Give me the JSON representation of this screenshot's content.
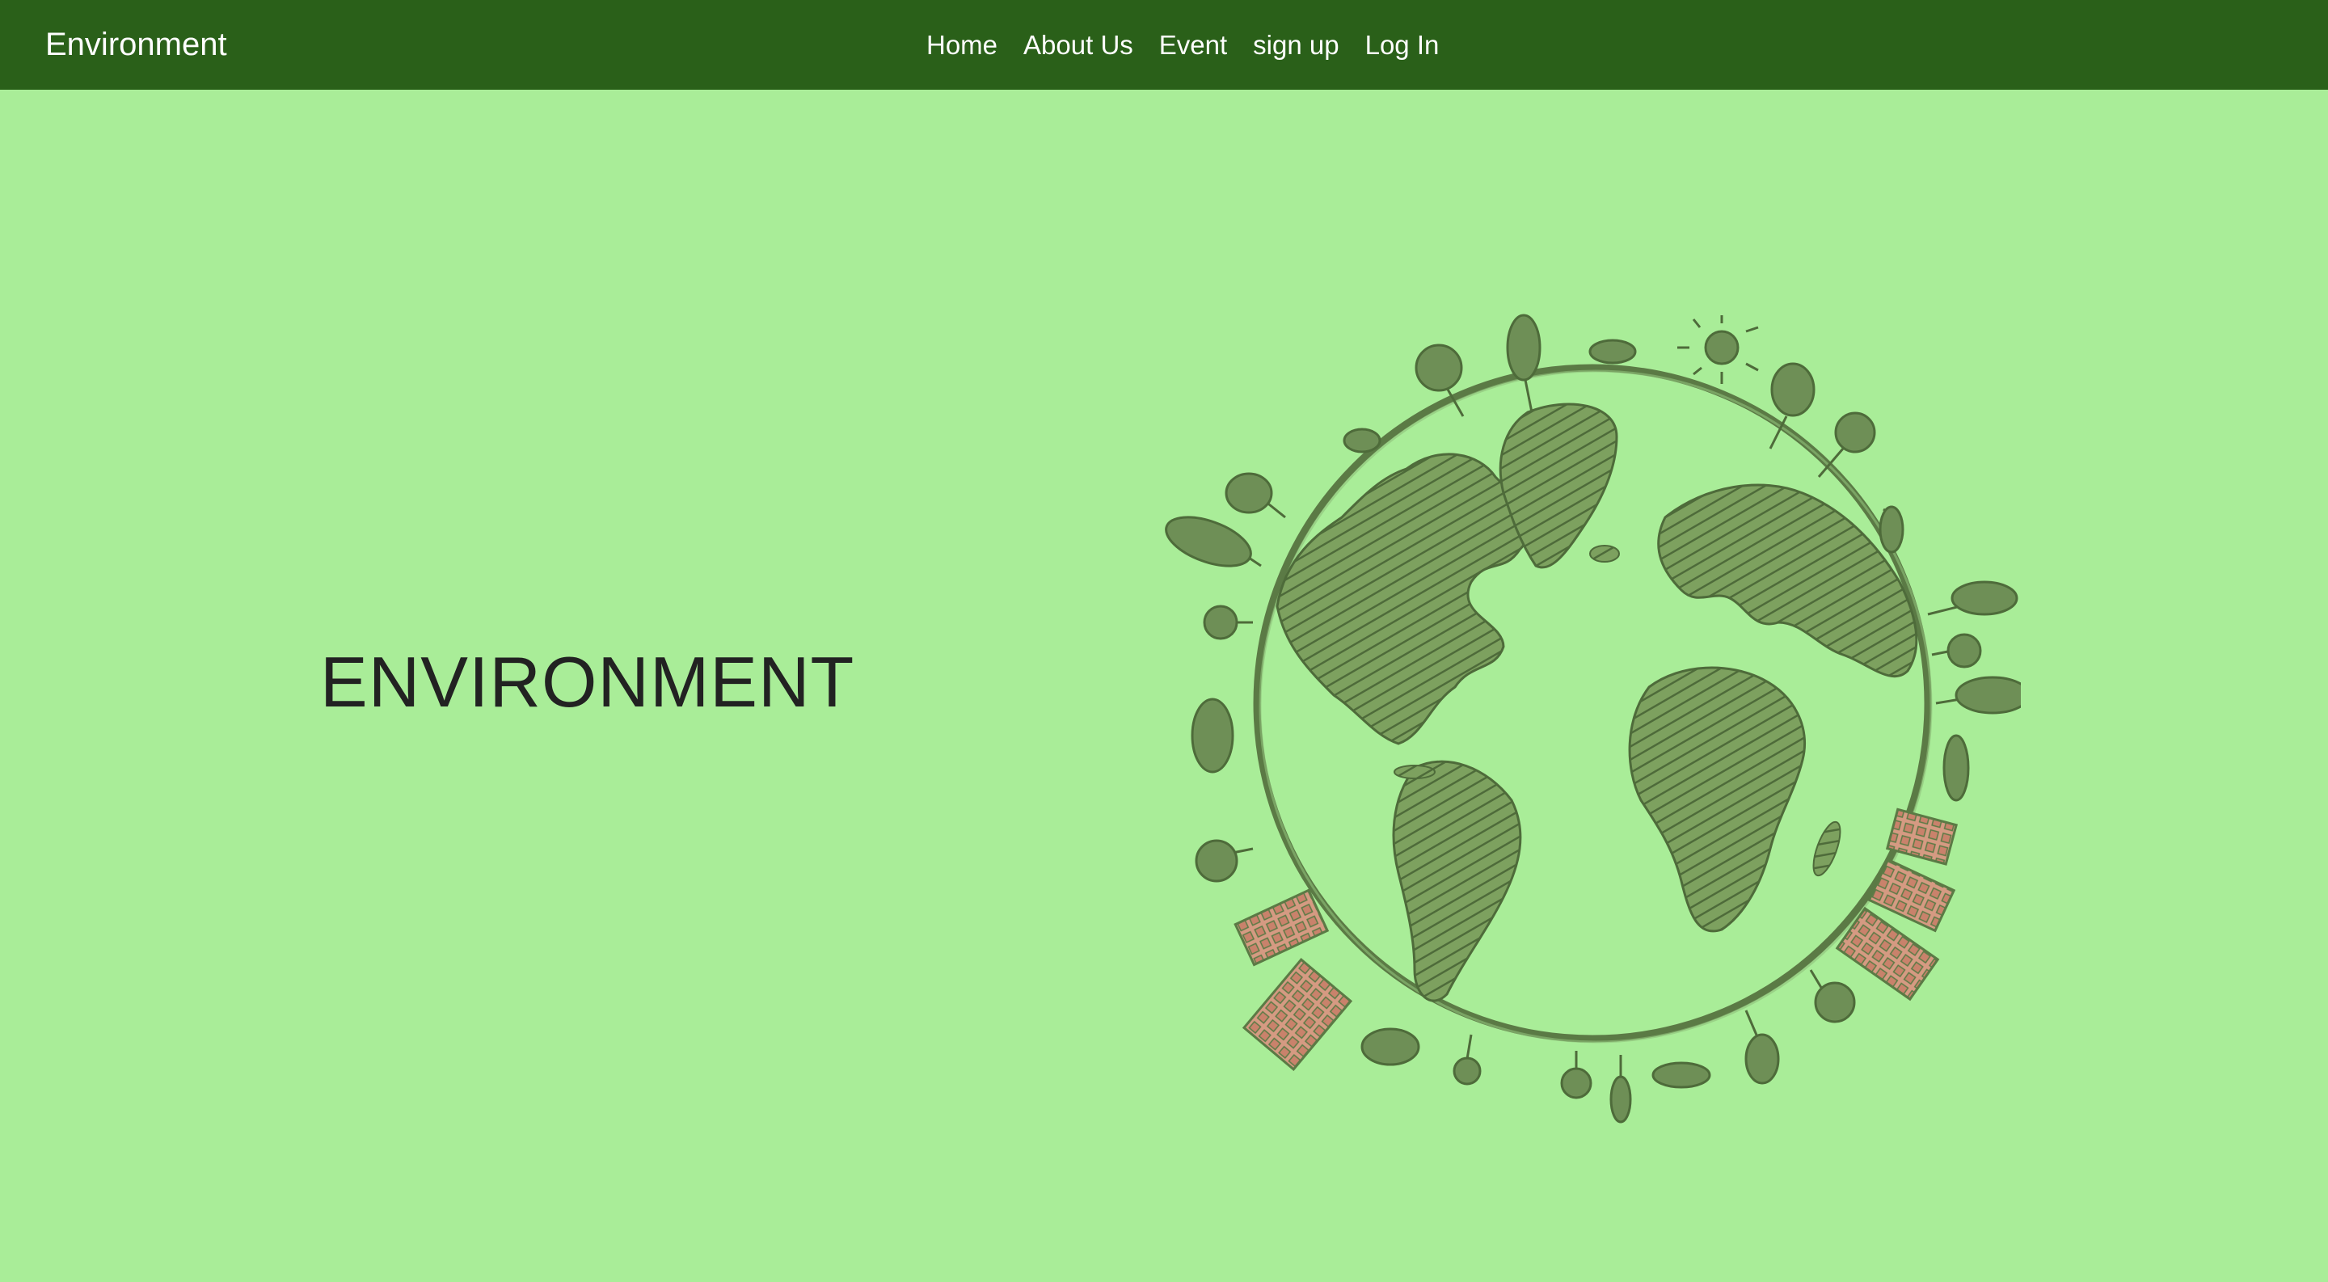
{
  "navbar": {
    "brand": "Environment",
    "links": [
      {
        "label": "Home"
      },
      {
        "label": "About Us"
      },
      {
        "label": "Event"
      },
      {
        "label": "sign up"
      },
      {
        "label": "Log In"
      }
    ]
  },
  "hero": {
    "title": "ENVIRONMENT",
    "illustration_icon": "earth-globe-sketch-icon"
  },
  "colors": {
    "navbar_bg": "#2a6019",
    "page_bg": "#a9ed98",
    "illustration": "#5b7a45",
    "buildings": "#d59a82"
  }
}
